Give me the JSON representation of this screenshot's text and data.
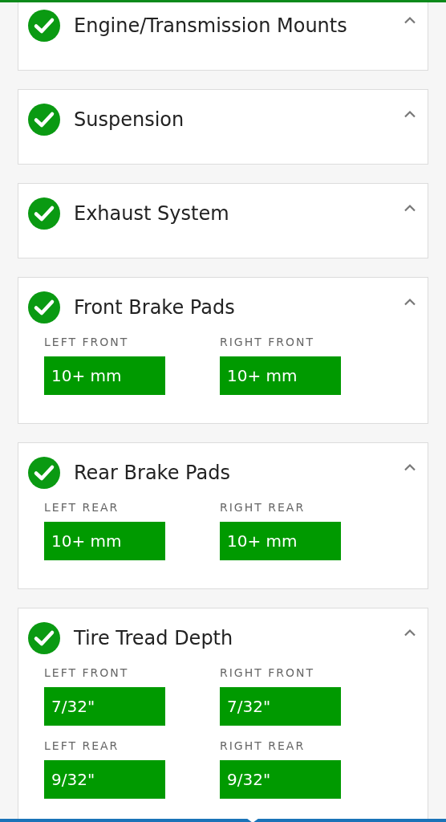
{
  "sections": [
    {
      "title": "Engine/Transmission Mounts",
      "passed": true,
      "expanded": true
    },
    {
      "title": "Suspension",
      "passed": true,
      "expanded": true
    },
    {
      "title": "Exhaust System",
      "passed": true,
      "expanded": true
    },
    {
      "title": "Front Brake Pads",
      "passed": true,
      "expanded": true,
      "readings": [
        {
          "label": "LEFT FRONT",
          "value": "10+ mm",
          "color": "#009a00"
        },
        {
          "label": "RIGHT FRONT",
          "value": "10+ mm",
          "color": "#009a00"
        }
      ]
    },
    {
      "title": "Rear Brake Pads",
      "passed": true,
      "expanded": true,
      "readings": [
        {
          "label": "LEFT REAR",
          "value": "10+ mm",
          "color": "#009a00"
        },
        {
          "label": "RIGHT REAR",
          "value": "10+ mm",
          "color": "#009a00"
        }
      ]
    },
    {
      "title": "Tire Tread Depth",
      "passed": true,
      "expanded": true,
      "readings": [
        {
          "label": "LEFT FRONT",
          "value": "7/32\"",
          "color": "#009a00"
        },
        {
          "label": "RIGHT FRONT",
          "value": "7/32\"",
          "color": "#009a00"
        },
        {
          "label": "LEFT REAR",
          "value": "9/32\"",
          "color": "#009a00"
        },
        {
          "label": "RIGHT REAR",
          "value": "9/32\"",
          "color": "#009a00"
        }
      ]
    }
  ]
}
